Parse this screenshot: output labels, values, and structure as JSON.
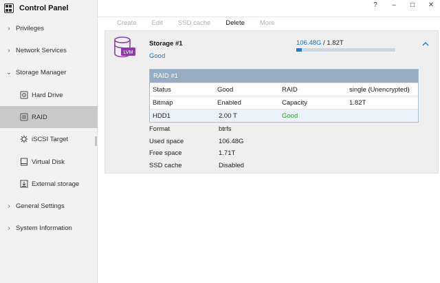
{
  "app": {
    "title": "Control Panel"
  },
  "window": {
    "help": "?",
    "minimize": "–",
    "maximize": "□",
    "close": "✕"
  },
  "sidebar": {
    "items": [
      {
        "label": "Privileges",
        "chevron": "›"
      },
      {
        "label": "Network Services",
        "chevron": "›"
      },
      {
        "label": "Storage Manager",
        "chevron": "⌄"
      },
      {
        "label": "General Settings",
        "chevron": "›"
      },
      {
        "label": "System Information",
        "chevron": "›"
      }
    ],
    "storage_children": [
      {
        "label": "Hard Drive",
        "icon": "hard-drive-icon"
      },
      {
        "label": "RAID",
        "icon": "raid-icon",
        "active": true
      },
      {
        "label": "iSCSI Target",
        "icon": "iscsi-icon"
      },
      {
        "label": "Virtual Disk",
        "icon": "virtual-disk-icon"
      },
      {
        "label": "External storage",
        "icon": "external-storage-icon"
      }
    ]
  },
  "toolbar": {
    "create": "Create",
    "edit": "Edit",
    "ssd_cache": "SSD cache",
    "delete": "Delete",
    "more": "More"
  },
  "storage": {
    "lvm_label": "LVM",
    "name": "Storage #1",
    "status": "Good",
    "used": "106.48G",
    "separator": " / ",
    "total": "1.82T",
    "usage_fraction": 0.057,
    "raid": {
      "title": "RAID #1",
      "rows": [
        [
          "Status",
          "Good",
          "RAID",
          "single (Unencrypted)"
        ],
        [
          "Bitmap",
          "Enabled",
          "Capacity",
          "1.82T"
        ]
      ],
      "hdd": {
        "name": "HDD1",
        "size": "2.00 T",
        "status": "Good"
      }
    },
    "info": [
      {
        "k": "Format",
        "v": "btrfs"
      },
      {
        "k": "Used space",
        "v": "106.48G"
      },
      {
        "k": "Free space",
        "v": "1.71T"
      },
      {
        "k": "SSD cache",
        "v": "Disabled"
      }
    ]
  },
  "colors": {
    "accent": "#2a78c8",
    "good_green": "#2e9a2e",
    "raid_header": "#97adc2",
    "active_nav": "#c9c9c9"
  }
}
